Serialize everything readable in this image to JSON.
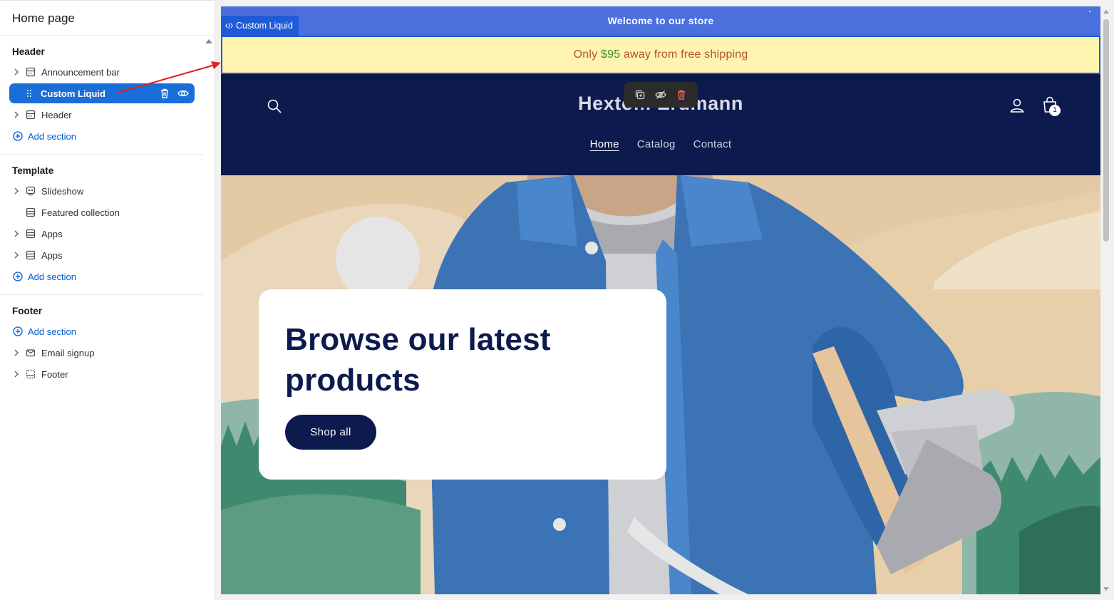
{
  "sidebar": {
    "title": "Home page",
    "header_group": {
      "title": "Header",
      "items": [
        {
          "label": "Announcement bar",
          "icon": "section-icon"
        },
        {
          "label": "Custom Liquid",
          "icon": "drag-handle-icon",
          "selected": true
        },
        {
          "label": "Header",
          "icon": "section-icon"
        }
      ],
      "add_label": "Add section"
    },
    "template_group": {
      "title": "Template",
      "items": [
        {
          "label": "Slideshow",
          "icon": "slideshow-icon"
        },
        {
          "label": "Featured collection",
          "icon": "section-icon"
        },
        {
          "label": "Apps",
          "icon": "apps-icon"
        },
        {
          "label": "Apps",
          "icon": "apps-icon"
        }
      ],
      "add_label": "Add section"
    },
    "footer_group": {
      "title": "Footer",
      "add_label": "Add section",
      "items": [
        {
          "label": "Email signup",
          "icon": "email-icon"
        },
        {
          "label": "Footer",
          "icon": "footer-icon"
        }
      ]
    }
  },
  "preview": {
    "announcement": "Welcome to our store",
    "custom_liquid_tag": "Custom Liquid",
    "shipping": {
      "prefix": "Only ",
      "amount": "$95",
      "suffix": " away from free shipping"
    },
    "logo": "Hextom Erdmann",
    "cart_count": "1",
    "nav": [
      "Home",
      "Catalog",
      "Contact"
    ],
    "hero": {
      "title": "Browse our latest products",
      "button": "Shop all"
    }
  },
  "colors": {
    "accent": "#1a6ed8",
    "announcement_bg": "#4b6fdc",
    "shipping_bg": "#fff3b0",
    "header_bg": "#0d1a4d",
    "annotation_arrow": "#e0201b"
  }
}
